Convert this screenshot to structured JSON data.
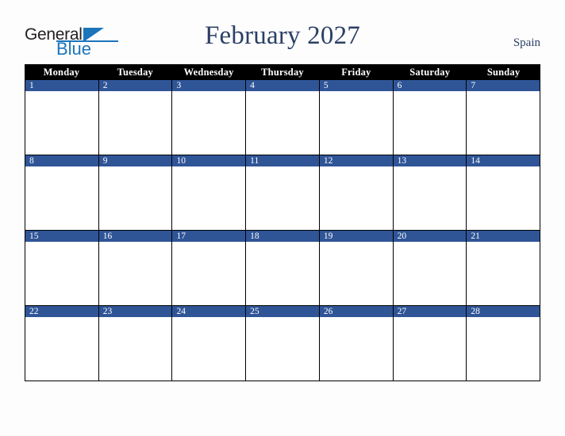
{
  "logo": {
    "word1": "General",
    "word2": "Blue",
    "triangle_icon": "triangle-icon",
    "color_dark": "#231f20",
    "color_blue": "#1b75bb"
  },
  "header": {
    "title": "February 2027",
    "country": "Spain",
    "title_color": "#2b3f66"
  },
  "calendar": {
    "weekdays": [
      "Monday",
      "Tuesday",
      "Wednesday",
      "Thursday",
      "Friday",
      "Saturday",
      "Sunday"
    ],
    "header_bg": "#000000",
    "header_text_color": "#ffffff",
    "date_band_color": "#2f5597",
    "date_text_color": "#ffffff",
    "cell_bg": "#ffffff",
    "weeks": [
      [
        {
          "day": "1"
        },
        {
          "day": "2"
        },
        {
          "day": "3"
        },
        {
          "day": "4"
        },
        {
          "day": "5"
        },
        {
          "day": "6"
        },
        {
          "day": "7"
        }
      ],
      [
        {
          "day": "8"
        },
        {
          "day": "9"
        },
        {
          "day": "10"
        },
        {
          "day": "11"
        },
        {
          "day": "12"
        },
        {
          "day": "13"
        },
        {
          "day": "14"
        }
      ],
      [
        {
          "day": "15"
        },
        {
          "day": "16"
        },
        {
          "day": "17"
        },
        {
          "day": "18"
        },
        {
          "day": "19"
        },
        {
          "day": "20"
        },
        {
          "day": "21"
        }
      ],
      [
        {
          "day": "22"
        },
        {
          "day": "23"
        },
        {
          "day": "24"
        },
        {
          "day": "25"
        },
        {
          "day": "26"
        },
        {
          "day": "27"
        },
        {
          "day": "28"
        }
      ]
    ]
  }
}
